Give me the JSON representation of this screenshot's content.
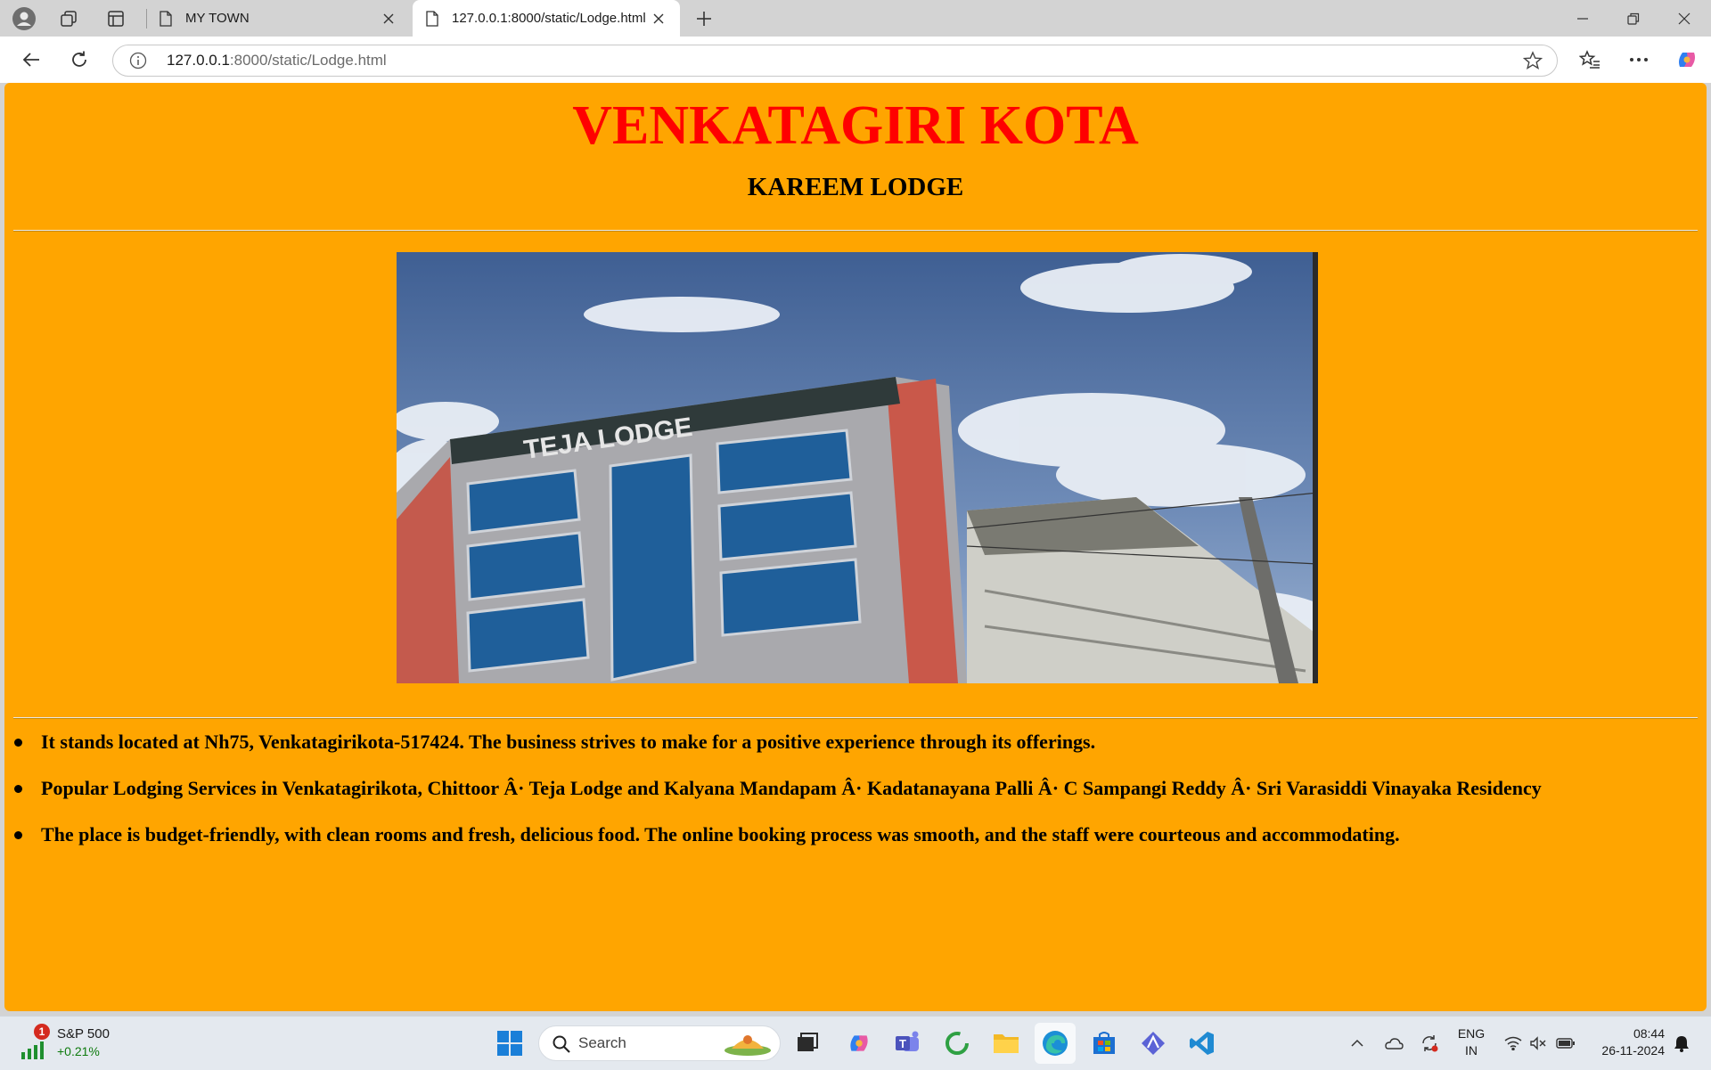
{
  "browser": {
    "tabs": [
      {
        "title": "MY TOWN",
        "active": false
      },
      {
        "title": "127.0.0.1:8000/static/Lodge.html",
        "active": true
      }
    ],
    "address": {
      "host": "127.0.0.1",
      "path": ":8000/static/Lodge.html"
    },
    "icons": [
      "profile-icon",
      "workspaces-icon",
      "tab-actions-icon",
      "new-tab-icon",
      "minimize-icon",
      "restore-icon",
      "close-window-icon",
      "back-icon",
      "refresh-icon",
      "site-info-icon",
      "favorite-star-icon",
      "favorites-icon",
      "more-icon",
      "copilot-icon"
    ]
  },
  "page": {
    "background": "#ffa500",
    "title": "VENKATAGIRI KOTA",
    "title_color": "#ff0000",
    "subtitle": "KAREEM LODGE",
    "image_sign_text": "TEJA LODGE",
    "bullets": [
      "It stands located at Nh75, Venkatagirikota-517424. The business strives to make for a positive experience through its offerings.",
      "Popular Lodging Services in Venkatagirikota, Chittoor Â· Teja Lodge and Kalyana Mandapam Â· Kadatanayana Palli Â· C Sampangi Reddy Â· Sri Varasiddi Vinayaka Residency",
      "The place is budget-friendly, with clean rooms and fresh, delicious food. The online booking process was smooth, and the staff were courteous and accommodating."
    ]
  },
  "taskbar": {
    "stock": {
      "badge": "1",
      "name": "S&P 500",
      "change": "+0.21%"
    },
    "search_placeholder": "Search",
    "apps": [
      "start-icon",
      "task-view-icon",
      "copilot-app-icon",
      "teams-icon",
      "refresh-app-icon",
      "file-explorer-icon",
      "edge-icon",
      "store-icon",
      "affinity-icon",
      "vscode-icon"
    ],
    "tray": {
      "lang_line1": "ENG",
      "lang_line2": "IN",
      "time": "08:44",
      "date": "26-11-2024"
    }
  }
}
